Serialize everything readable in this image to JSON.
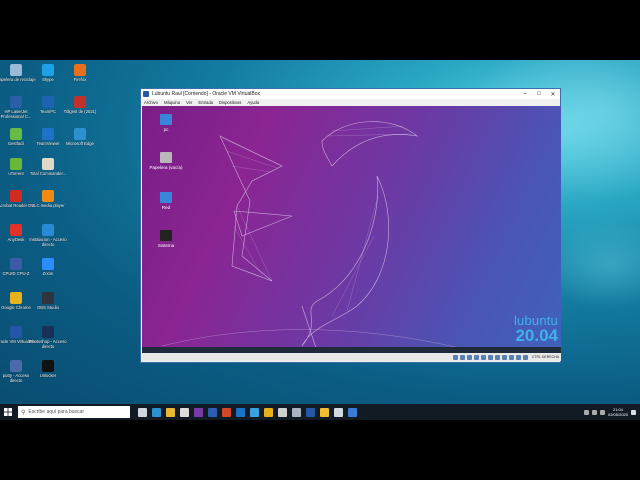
{
  "desktop": {
    "icons": [
      {
        "label": "Papelera de reciclaje",
        "color": "#9bbad6"
      },
      {
        "label": "Skype",
        "color": "#1ea0e6"
      },
      {
        "label": "Firefox",
        "color": "#e8701c"
      },
      {
        "label": "HP LaserJet Professional C...",
        "color": "#2a5fa8"
      },
      {
        "label": "TeamPC",
        "color": "#1c63b0"
      },
      {
        "label": "Tdlgest de (2021)",
        "color": "#c0302c"
      },
      {
        "label": "Gestfacil",
        "color": "#66bb44"
      },
      {
        "label": "TeamViewer",
        "color": "#1e72c8"
      },
      {
        "label": "Microsoft Edge",
        "color": "#2c8fd0"
      },
      {
        "label": "uTorrent",
        "color": "#6ab83a"
      },
      {
        "label": "Total Commander...",
        "color": "#e0d9c8"
      },
      {
        "label": "Acrobat Reader DC",
        "color": "#d12a1e"
      },
      {
        "label": "VLC media player",
        "color": "#f08a14"
      },
      {
        "label": "AnyDesk",
        "color": "#e0322a"
      },
      {
        "label": "Instalacion - Acceso directo",
        "color": "#2a8ad8"
      },
      {
        "label": "CPUID CPU-Z",
        "color": "#3b5aa8"
      },
      {
        "label": "Zoom",
        "color": "#2d8cff"
      },
      {
        "label": "Google Chrome",
        "color": "#e6b21c"
      },
      {
        "label": "OBS Studio",
        "color": "#30343a"
      },
      {
        "label": "Oracle VM VirtualBox",
        "color": "#2457a8"
      },
      {
        "label": "Photoshop - Acceso directo",
        "color": "#1a2f58"
      },
      {
        "label": "putty - Acceso directo",
        "color": "#4a6aa8"
      },
      {
        "label": "Unlocker",
        "color": "#111111"
      }
    ]
  },
  "vm_window": {
    "title": "Lubuntu Raul [Corriendo] - Oracle VM VirtualBox",
    "controls": {
      "minimize": "–",
      "maximize": "□",
      "close": "✕"
    },
    "menu": [
      "Archivo",
      "Máquina",
      "Ver",
      "Entrada",
      "Dispositivos",
      "Ayuda"
    ],
    "guest": {
      "icons": [
        {
          "label": "pc",
          "color": "#3a86d8"
        },
        {
          "label": "Papelera (vacía)",
          "color": "#b8b8b8"
        },
        {
          "label": "Red",
          "color": "#3a86d8"
        },
        {
          "label": "Sistema",
          "color": "#222222"
        }
      ],
      "brand_name": "lubuntu",
      "brand_version": "20.04"
    },
    "status": {
      "host_key": "CTRL DERECHA"
    }
  },
  "taskbar": {
    "search_placeholder": "Escribe aquí para buscar",
    "pinned": [
      {
        "name": "task-view-icon",
        "color": "#cfd6de"
      },
      {
        "name": "edge-icon",
        "color": "#2c8fd0"
      },
      {
        "name": "file-explorer-icon",
        "color": "#e8b830"
      },
      {
        "name": "store-icon",
        "color": "#dcdcdc"
      },
      {
        "name": "onenote-icon",
        "color": "#7a3aa8"
      },
      {
        "name": "word-icon",
        "color": "#2b5eb0"
      },
      {
        "name": "powerpoint-icon",
        "color": "#d24726"
      },
      {
        "name": "outlook-icon",
        "color": "#1a73c8"
      },
      {
        "name": "paint-icon",
        "color": "#3aa0e0"
      },
      {
        "name": "chrome-icon",
        "color": "#e6b21c"
      },
      {
        "name": "clock-app-icon",
        "color": "#cfcfcf"
      },
      {
        "name": "snip-icon",
        "color": "#aab4c0"
      },
      {
        "name": "virtualbox-icon",
        "color": "#2457a8"
      },
      {
        "name": "vm-taskbar-icon",
        "color": "#f0c030"
      },
      {
        "name": "cloud-icon",
        "color": "#d0d8e0"
      },
      {
        "name": "media-icon",
        "color": "#3a7ad8"
      }
    ],
    "time": "21:04",
    "date": "02/05/2020"
  }
}
